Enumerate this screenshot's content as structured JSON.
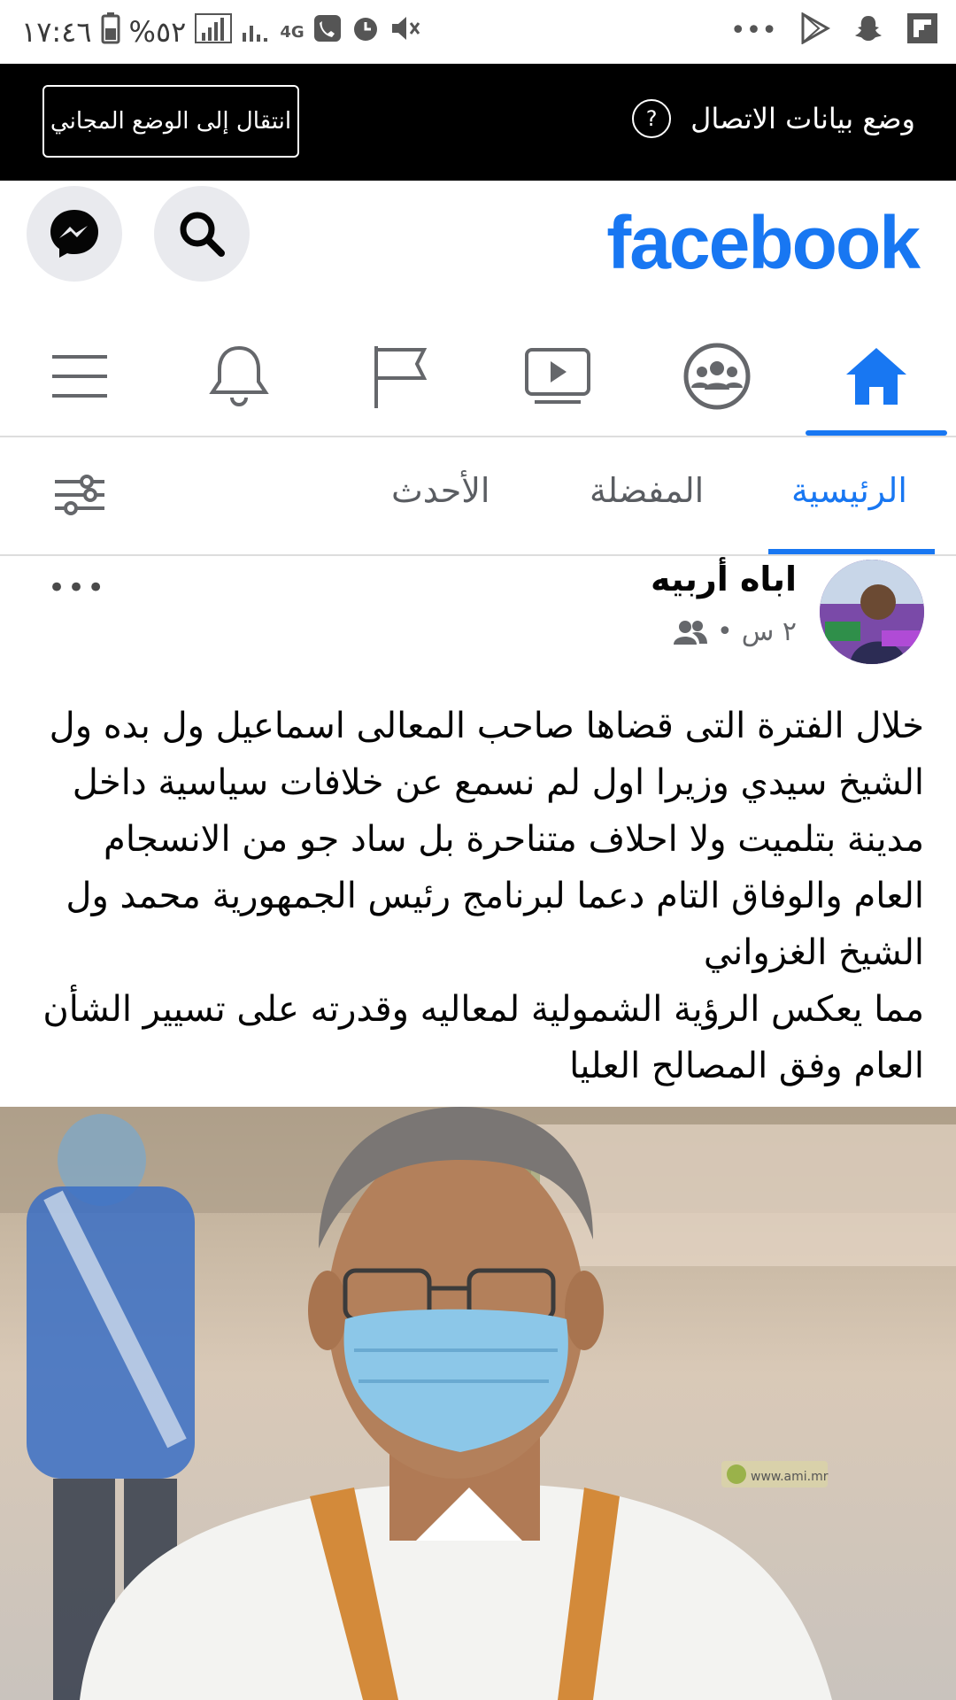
{
  "status_bar": {
    "time": "١٧:٤٦",
    "battery": "%٥٢",
    "network": "4G"
  },
  "banner": {
    "title": "وضع بيانات الاتصال",
    "free_mode_button": "انتقال إلى الوضع المجاني",
    "help_icon": "?"
  },
  "header": {
    "logo": "facebook",
    "brand_color": "#1877f2"
  },
  "nav": {
    "items": [
      "home-icon",
      "groups-icon",
      "watch-icon",
      "pages-flag-icon",
      "bell-icon",
      "menu-icon"
    ],
    "active": "home-icon"
  },
  "tabs": {
    "home": "الرئيسية",
    "favorites": "المفضلة",
    "recent": "الأحدث",
    "active": "home"
  },
  "post": {
    "author": "اباه أربيه",
    "time": "٢ س",
    "separator": "•",
    "audience_icon": "friends-icon",
    "more": "•••",
    "body": "خلال الفترة التى قضاها صاحب المعالى اسماعيل ول بده ول الشيخ سيدي وزيرا اول لم نسمع عن خلافات سياسية داخل مدينة بتلميت ولا احلاف متناحرة بل ساد جو من الانسجام العام والوفاق التام دعما لبرنامج رئيس الجمهورية محمد ول الشيخ الغزواني\n مما يعكس الرؤية الشمولية لمعاليه وقدرته على تسيير الشأن العام وفق المصالح العليا",
    "image_watermark": "www.ami.mr"
  }
}
